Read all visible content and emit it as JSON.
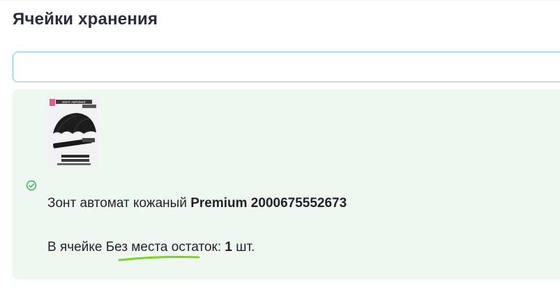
{
  "page": {
    "title": "Ячейки хранения"
  },
  "search": {
    "value": "",
    "placeholder": ""
  },
  "result": {
    "status_icon": "check-circle-icon",
    "product_name": "Зонт автомат кожаный",
    "product_code": "Premium 2000675552673",
    "cell_prefix": "В ячейке",
    "cell_name": "Без места",
    "balance_label": "остаток:",
    "balance_value": "1",
    "unit": "шт.",
    "thumbnail": {
      "icon": "umbrella-product-image",
      "caption_top": "ЗОНТ АВТОМАТ"
    }
  },
  "colors": {
    "card_bg": "#eef8f1",
    "input_border": "#7fc4ea",
    "check": "#44b26b",
    "highlight_underline": "#7ed321"
  }
}
